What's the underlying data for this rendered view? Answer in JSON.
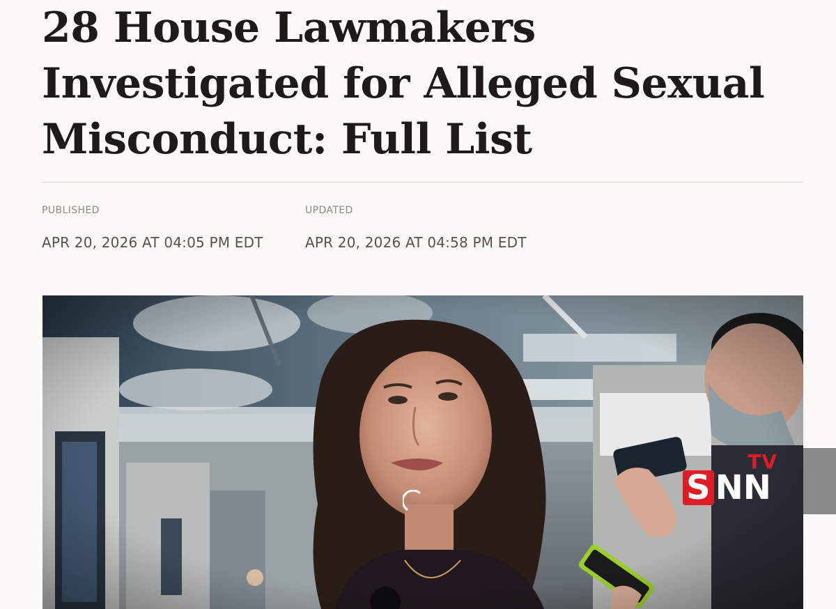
{
  "article": {
    "headline": "28 House Lawmakers Investigated for Alleged Sexual Misconduct: Full List",
    "published_label": "PUBLISHED",
    "published_value": "APR 20, 2026 AT 04:05 PM EDT",
    "updated_label": "UPDATED",
    "updated_value": "APR 20, 2026 AT 04:58 PM EDT"
  },
  "hero_image": {
    "watermark": {
      "main": "SNN",
      "suffix": "TV"
    },
    "colors": {
      "logo_red": "#e01b24",
      "logo_white": "#ffffff"
    }
  },
  "icons": {
    "loading": "loading-spinner-icon"
  }
}
